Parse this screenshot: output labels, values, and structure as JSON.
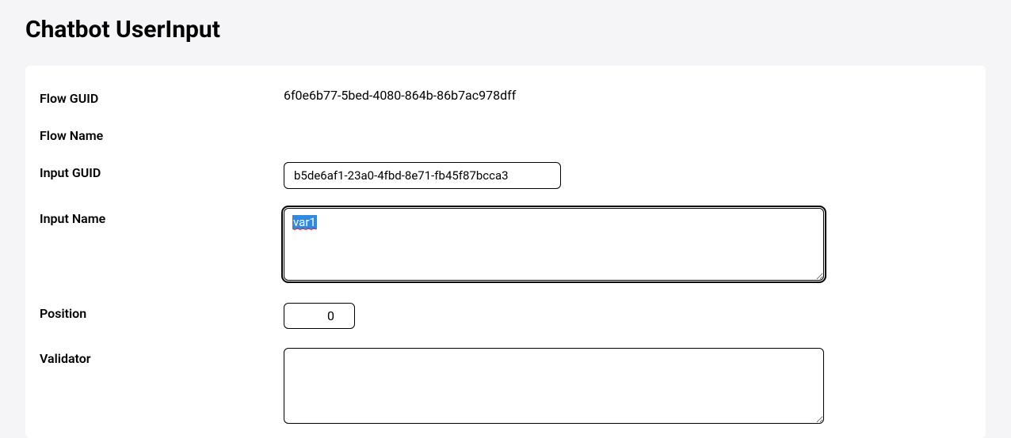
{
  "page": {
    "title": "Chatbot UserInput"
  },
  "form": {
    "flow_guid": {
      "label": "Flow GUID",
      "value": "6f0e6b77-5bed-4080-864b-86b7ac978dff"
    },
    "flow_name": {
      "label": "Flow Name",
      "value": ""
    },
    "input_guid": {
      "label": "Input GUID",
      "value": "b5de6af1-23a0-4fbd-8e71-fb45f87bcca3"
    },
    "input_name": {
      "label": "Input Name",
      "value": "var1"
    },
    "position": {
      "label": "Position",
      "value": "0"
    },
    "validator": {
      "label": "Validator",
      "value": ""
    }
  }
}
